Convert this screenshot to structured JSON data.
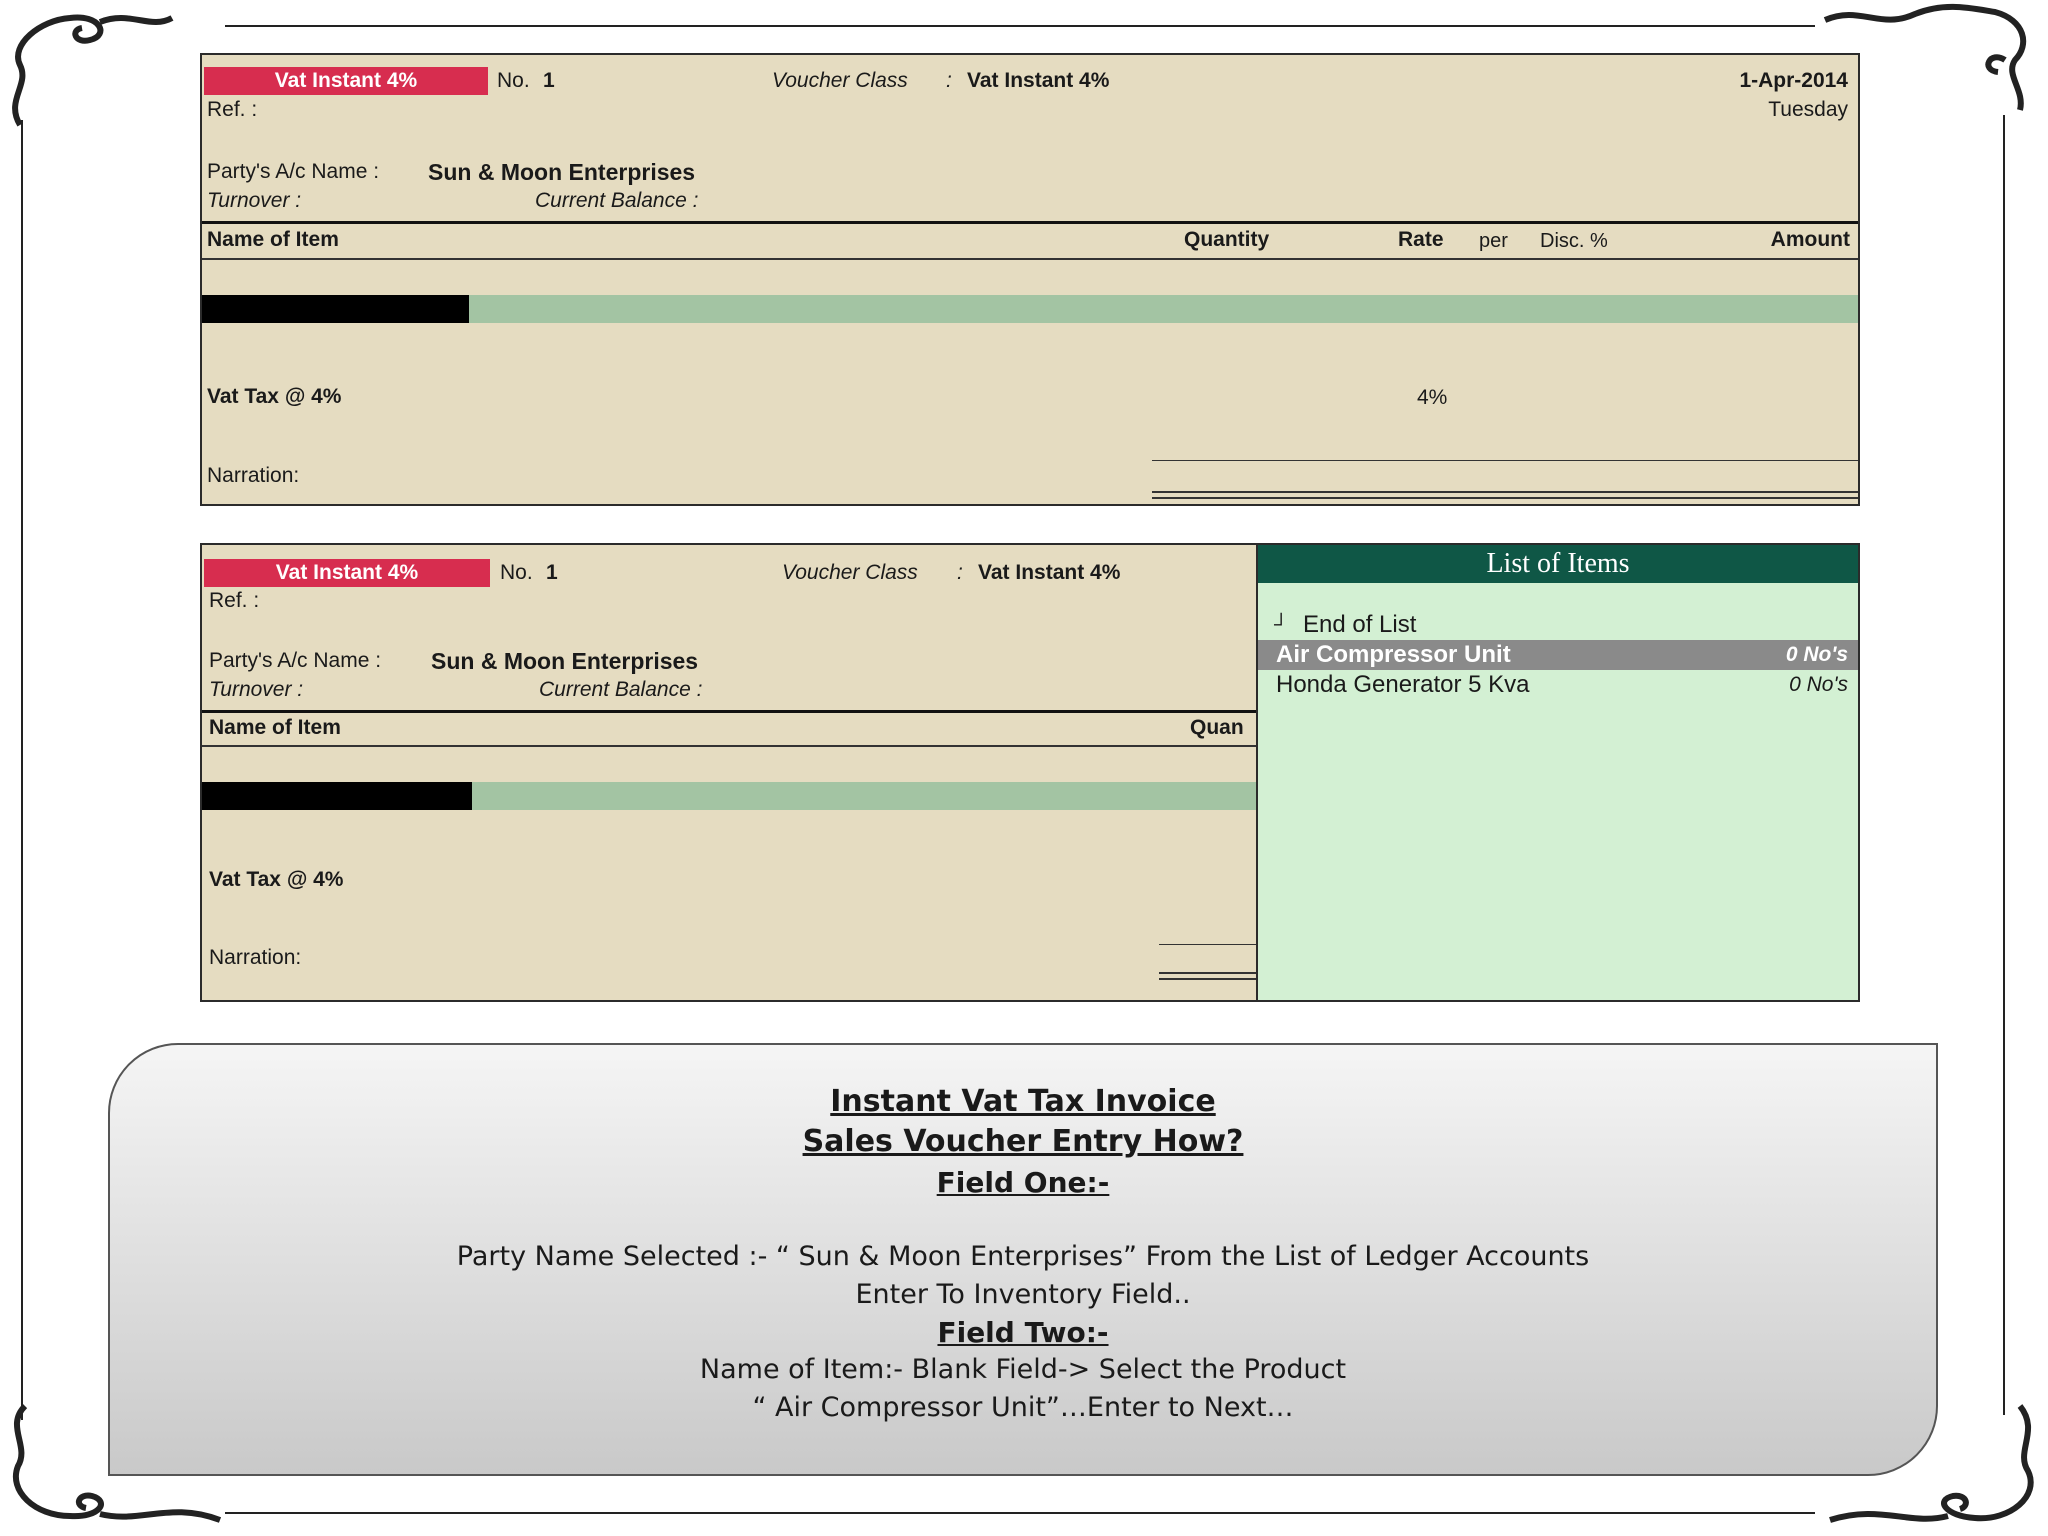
{
  "voucher_top": {
    "badge": "Vat Instant 4%",
    "no_label": "No.",
    "no_value": "1",
    "voucher_class_label": "Voucher Class",
    "colon": ":",
    "voucher_class_value": "Vat Instant 4%",
    "date": "1-Apr-2014",
    "day": "Tuesday",
    "ref_label": "Ref. :",
    "party_label": "Party's A/c Name :",
    "party_value": "Sun & Moon Enterprises",
    "turnover_label": "Turnover  :",
    "current_balance_label": "Current Balance  :",
    "columns": {
      "name": "Name of Item",
      "quantity": "Quantity",
      "rate": "Rate",
      "per": "per",
      "disc": "Disc. %",
      "amount": "Amount"
    },
    "tax_label": "Vat Tax @ 4%",
    "tax_rate": "4%",
    "narration_label": "Narration:"
  },
  "voucher_bottom": {
    "badge": "Vat Instant 4%",
    "no_label": "No.",
    "no_value": "1",
    "voucher_class_label": "Voucher Class",
    "colon": ":",
    "voucher_class_value": "Vat Instant 4%",
    "ref_label": "Ref. :",
    "party_label": "Party's A/c Name :",
    "party_value": "Sun & Moon Enterprises",
    "turnover_label": "Turnover  :",
    "current_balance_label": "Current Balance  :",
    "col_name": "Name of Item",
    "col_quantity_partial": "Quan",
    "tax_label": "Vat Tax @ 4%",
    "narration_label": "Narration:"
  },
  "list_of_items": {
    "title": "List of Items",
    "end_marker": "┘",
    "end_label": "End of List",
    "items": [
      {
        "name": "Air Compressor Unit",
        "qty": "0 No's",
        "selected": true
      },
      {
        "name": "Honda Generator 5 Kva",
        "qty": "0 No's",
        "selected": false
      }
    ]
  },
  "info": {
    "heading1": "Instant Vat Tax Invoice",
    "heading2": "Sales Voucher Entry How?",
    "heading3": " Field  One:-",
    "line1": "Party Name  Selected :- “ Sun & Moon Enterprises”  From the List of Ledger Accounts",
    "line2": "Enter To Inventory Field..",
    "heading4": "Field Two:-",
    "line3": "Name of Item:- Blank Field-> Select the Product",
    "line4": "“ Air Compressor Unit”…Enter to Next…"
  }
}
